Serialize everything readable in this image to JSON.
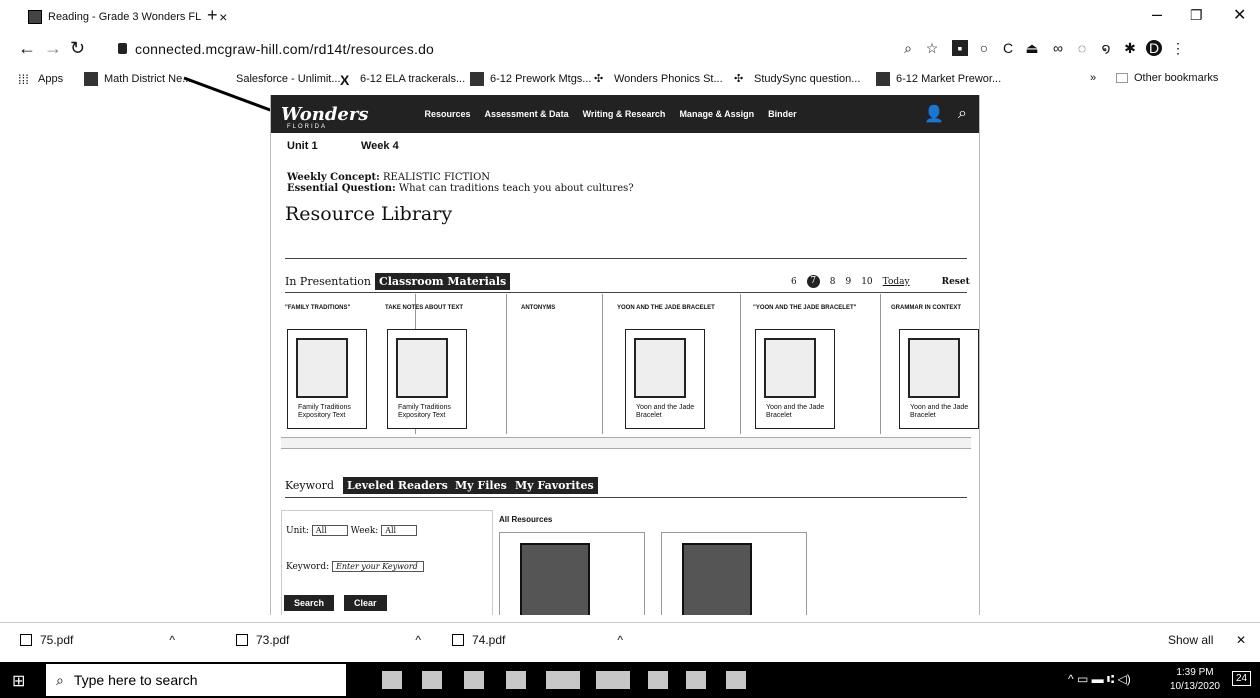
{
  "browser": {
    "tab_title": "Reading - Grade 3 Wonders FL",
    "tab_close": "×",
    "new_tab": "+",
    "url": "connected.mcgraw-hill.com/rd14t/resources.do",
    "window_controls": [
      "–",
      "❐",
      "✕"
    ]
  },
  "bookmarks": [
    {
      "label": "Apps"
    },
    {
      "label": "Math District Ne..."
    },
    {
      "label": "Salesforce - Unlimit..."
    },
    {
      "label": "6-12 ELA trackerals..."
    },
    {
      "label": "6-12 Prework Mtgs..."
    },
    {
      "label": "Wonders Phonics St..."
    },
    {
      "label": "StudySync question..."
    },
    {
      "label": "6-12 Market Prewor..."
    },
    {
      "label": "»"
    },
    {
      "label": "Other bookmarks"
    }
  ],
  "wonders": {
    "logo": "Wonders",
    "logo_sub": "FLORIDA",
    "nav": [
      "Resources",
      "Assessment & Data",
      "Writing & Research",
      "Manage & Assign",
      "Binder"
    ],
    "unit": "Unit 1",
    "week": "Week 4",
    "weekly_concept_label": "Weekly Concept:",
    "weekly_concept": "REALISTIC FICTION",
    "essential_question_label": "Essential Question:",
    "essential_question": "What can traditions teach you about cultures?",
    "title": "Resource Library",
    "tab_presentation": "In Presentation",
    "tab_classroom": "Classroom Materials",
    "pages": [
      "6",
      "7",
      "8",
      "9",
      "10"
    ],
    "today": "Today",
    "reset": "Reset",
    "cards": [
      {
        "title": "\"FAMILY TRADITIONS\"",
        "caption": "Family Traditions Expository Text"
      },
      {
        "title": "TAKE NOTES ABOUT TEXT",
        "caption": "Family Traditions Expository Text"
      },
      {
        "title": "ANTONYMS",
        "caption": ""
      },
      {
        "title": "YOON AND THE JADE BRACELET",
        "caption": "Yoon and the Jade Bracelet"
      },
      {
        "title": "\"YOON AND THE JADE BRACELET\"",
        "caption": "Yoon and the Jade Bracelet"
      },
      {
        "title": "GRAMMAR IN CONTEXT",
        "caption": "Yoon and the Jade Bracelet"
      }
    ],
    "tab_keyword": "Keyword",
    "tab_leveled": "Leveled Readers",
    "tab_myfiles": "My Files",
    "tab_favorites": "My Favorites",
    "unit_label": "Unit:",
    "unit_value": "All",
    "week_label": "Week:",
    "week_value": "All",
    "keyword_label": "Keyword:",
    "keyword_placeholder": "Enter your Keyword",
    "search_btn": "Search",
    "clear_btn": "Clear",
    "all_resources": "All Resources"
  },
  "downloads": [
    {
      "name": "75.pdf"
    },
    {
      "name": "73.pdf"
    },
    {
      "name": "74.pdf"
    }
  ],
  "downloads_show_all": "Show all",
  "taskbar": {
    "search_placeholder": "Type here to search",
    "time": "1:39 PM",
    "date": "10/13/2020",
    "notif": "24"
  }
}
